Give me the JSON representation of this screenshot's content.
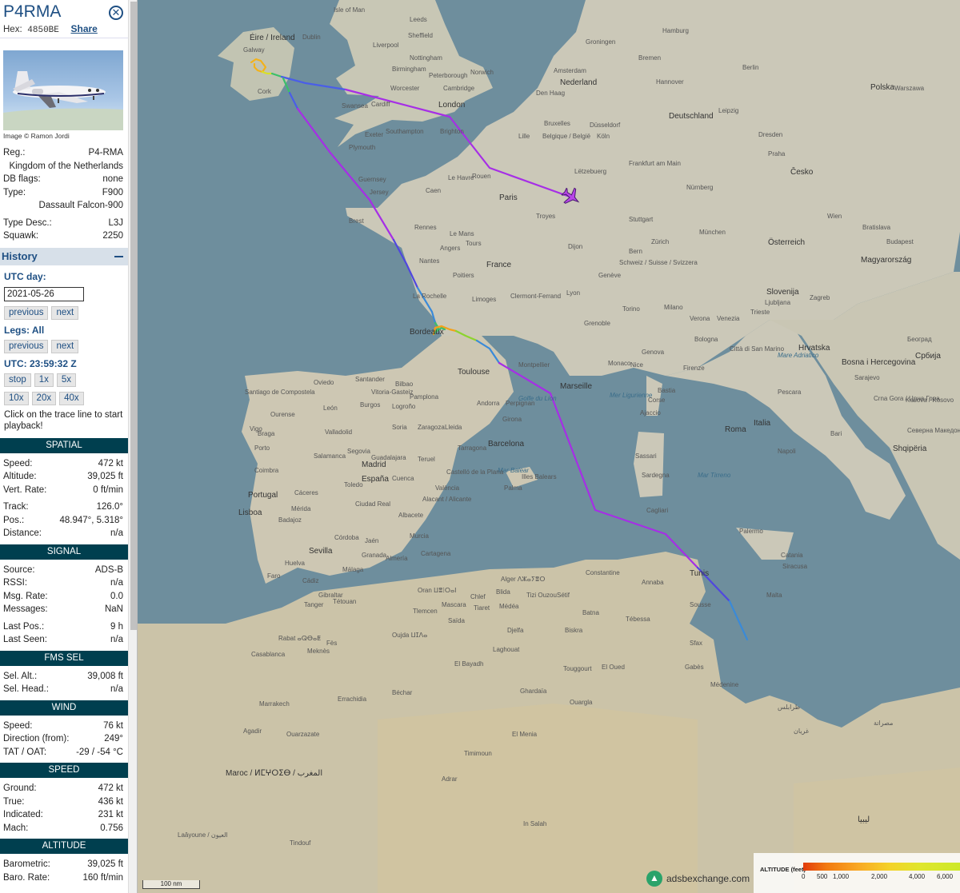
{
  "aircraft": {
    "callsign": "P4RMA",
    "hex_label": "Hex:",
    "hex": "4850BE",
    "share_label": "Share",
    "photo_credit": "Image © Ramon Jordi"
  },
  "details": [
    {
      "key": "Reg.:",
      "value": "P4-RMA"
    },
    {
      "key": "",
      "value": "Kingdom of the Netherlands"
    },
    {
      "key": "DB flags:",
      "value": "none"
    },
    {
      "key": "Type:",
      "value": "F900"
    },
    {
      "key": "",
      "value": "Dassault Falcon-900"
    },
    {
      "key": "Type Desc.:",
      "value": "L3J"
    },
    {
      "key": "Squawk:",
      "value": "2250"
    }
  ],
  "history": {
    "title": "History",
    "utc_day_label": "UTC day:",
    "date_value": "2021-05-26",
    "previous": "previous",
    "next": "next",
    "legs_label": "Legs: All",
    "utc_time_label": "UTC: 23:59:32 Z",
    "stop": "stop",
    "x1": "1x",
    "x5": "5x",
    "x10": "10x",
    "x20": "20x",
    "x40": "40x",
    "hint": "Click on the trace line to start playback!"
  },
  "sections": {
    "spatial": "SPATIAL",
    "signal": "SIGNAL",
    "fms": "FMS SEL",
    "wind": "WIND",
    "speed": "SPEED",
    "altitude": "ALTITUDE"
  },
  "spatial": {
    "speed": {
      "key": "Speed:",
      "value": "472 kt"
    },
    "altitude": {
      "key": "Altitude:",
      "value": "39,025 ft"
    },
    "vert_rate": {
      "key": "Vert. Rate:",
      "value": "0 ft/min"
    },
    "track": {
      "key": "Track:",
      "value": "126.0°"
    },
    "pos": {
      "key": "Pos.:",
      "value": "48.947°, 5.318°"
    },
    "distance": {
      "key": "Distance:",
      "value": "n/a"
    }
  },
  "signal": {
    "source": {
      "key": "Source:",
      "value": "ADS-B"
    },
    "rssi": {
      "key": "RSSI:",
      "value": "n/a"
    },
    "msg_rate": {
      "key": "Msg. Rate:",
      "value": "0.0"
    },
    "messages": {
      "key": "Messages:",
      "value": "NaN"
    },
    "last_pos": {
      "key": "Last Pos.:",
      "value": "9 h"
    },
    "last_seen": {
      "key": "Last Seen:",
      "value": "n/a"
    }
  },
  "fms": {
    "sel_alt": {
      "key": "Sel. Alt.:",
      "value": "39,008 ft"
    },
    "sel_head": {
      "key": "Sel. Head.:",
      "value": "n/a"
    }
  },
  "wind": {
    "speed": {
      "key": "Speed:",
      "value": "76 kt"
    },
    "direction": {
      "key": "Direction (from):",
      "value": "249°"
    },
    "tat_oat": {
      "key": "TAT / OAT:",
      "value": "-29 / -54 °C"
    }
  },
  "speed": {
    "ground": {
      "key": "Ground:",
      "value": "472 kt"
    },
    "true": {
      "key": "True:",
      "value": "436 kt"
    },
    "indicated": {
      "key": "Indicated:",
      "value": "231 kt"
    },
    "mach": {
      "key": "Mach:",
      "value": "0.756"
    }
  },
  "altitude": {
    "barometric": {
      "key": "Barometric:",
      "value": "39,025 ft"
    },
    "baro_rate": {
      "key": "Baro. Rate:",
      "value": "160 ft/min"
    }
  },
  "map": {
    "scale_label": "100 nm",
    "attribution": "adsbexchange.com",
    "legend_title": "ALTITUDE (feet)",
    "legend_ticks": [
      "0",
      "500",
      "1,000",
      "2,000",
      "4,000",
      "6,000"
    ],
    "colors": {
      "water": "#6e8e9d",
      "land": "#ccc9bb",
      "trail_high": "#a825e8",
      "trail_mid": "#5a4fe0",
      "sidebar_header": "#003f4f",
      "accent": "#1e4f83"
    },
    "labels": {
      "isle_of_man": "Isle of Man",
      "leeds": "Leeds",
      "sheffield": "Sheffield",
      "liverpool": "Liverpool",
      "nottingham": "Nottingham",
      "birmingham": "Birmingham",
      "peterborough": "Peterborough",
      "norwich": "Norwich",
      "worcester": "Worcester",
      "cambridge": "Cambridge",
      "london": "London",
      "cardiff": "Cardiff",
      "swansea": "Swansea",
      "southampton": "Southampton",
      "brighton": "Brighton",
      "exeter": "Exeter",
      "plymouth": "Plymouth",
      "eire": "Éire / Ireland",
      "dublin": "Dublin",
      "galway": "Galway",
      "cork": "Cork",
      "guernsey": "Guernsey",
      "jersey": "Jersey",
      "groningen": "Groningen",
      "amsterdam": "Amsterdam",
      "nederland": "Nederland",
      "den_haag": "Den Haag",
      "hamburg": "Hamburg",
      "bremen": "Bremen",
      "hannover": "Hannover",
      "berlin": "Berlin",
      "deutschland": "Deutschland",
      "dusseldorf": "Düsseldorf",
      "koln": "Köln",
      "frankfurt": "Frankfurt am Main",
      "leipzig": "Leipzig",
      "dresden": "Dresden",
      "nurnberg": "Nürnberg",
      "munchen": "München",
      "stuttgart": "Stuttgart",
      "praha": "Praha",
      "cesko": "Česko",
      "wien": "Wien",
      "bratislava": "Bratislava",
      "osterreich": "Österreich",
      "budapest": "Budapest",
      "magyarorszag": "Magyarország",
      "warszawa": "Warszawa",
      "polska": "Polska",
      "belgique": "Belgique / België",
      "bruxelles": "Bruxelles",
      "lille": "Lille",
      "luxembourg": "Lëtzebuerg",
      "paris": "Paris",
      "rouen": "Rouen",
      "le_havre": "Le Havre",
      "caen": "Caen",
      "rennes": "Rennes",
      "brest": "Brest",
      "nantes": "Nantes",
      "angers": "Angers",
      "tours": "Tours",
      "le_mans": "Le Mans",
      "france": "France",
      "troyes": "Troyes",
      "dijon": "Dijon",
      "la_rochelle": "La Rochelle",
      "poitiers": "Poitiers",
      "limoges": "Limoges",
      "clermont": "Clermont-Ferrand",
      "lyon": "Lyon",
      "geneve": "Genève",
      "schweiz": "Schweiz / Suisse / Svizzera",
      "bern": "Bern",
      "zurich": "Zürich",
      "grenoble": "Grenoble",
      "bordeaux": "Bordeaux",
      "toulouse": "Toulouse",
      "montpellier": "Montpellier",
      "marseille": "Marseille",
      "nice": "Nice",
      "monaco": "Monaco",
      "andorra": "Andorra",
      "perpignan": "Perpignan",
      "milano": "Milano",
      "torino": "Torino",
      "genova": "Genova",
      "verona": "Verona",
      "venezia": "Venezia",
      "bologna": "Bologna",
      "firenze": "Firenze",
      "italia": "Italia",
      "roma": "Roma",
      "napoli": "Napoli",
      "bari": "Bari",
      "pescara": "Pescara",
      "sanmarino": "Città di San Marino",
      "zagreb": "Zagreb",
      "slovenija": "Slovenija",
      "ljubljana": "Ljubljana",
      "trieste": "Trieste",
      "hrvatska": "Hrvatska",
      "bosna": "Bosna i Hercegovina",
      "sarajevo": "Sarajevo",
      "beograd": "Београд",
      "srbija": "Србија",
      "crnagora": "Crna Gora / Црна Гора",
      "kosovo": "Kosova / Kosovo",
      "shqiperia": "Shqipëria",
      "severna": "Северна Македонија",
      "sardegna": "Sardegna",
      "sassari": "Sassari",
      "cagliari": "Cagliari",
      "palermo": "Palermo",
      "catania": "Catania",
      "siracusa": "Siracusa",
      "malta": "Malta",
      "corse": "Corse",
      "ajaccio": "Ajaccio",
      "bastia": "Bastia",
      "espana": "España",
      "madrid": "Madrid",
      "barcelona": "Barcelona",
      "valencia": "València",
      "zaragoza": "Zaragoza",
      "bilbao": "Bilbao",
      "vitoria": "Vitoria-Gasteiz",
      "santander": "Santander",
      "oviedo": "Oviedo",
      "santiago": "Santiago de Compostela",
      "vigo": "Vigo",
      "ourense": "Ourense",
      "leon": "León",
      "burgos": "Burgos",
      "valladolid": "Valladolid",
      "salamanca": "Salamanca",
      "segovia": "Segovia",
      "toledo": "Toledo",
      "ciudad_real": "Ciudad Real",
      "cuenca": "Cuenca",
      "albacete": "Albacete",
      "murcia": "Murcia",
      "alicante": "Alacant / Alicante",
      "cartagena": "Cartagena",
      "almeria": "Almería",
      "granada": "Granada",
      "jaen": "Jaén",
      "cordoba": "Córdoba",
      "sevilla": "Sevilla",
      "huelva": "Huelva",
      "malaga": "Málaga",
      "cadiz": "Cádiz",
      "gibraltar": "Gibraltar",
      "badajoz": "Badajoz",
      "caceres": "Cáceres",
      "merida": "Mérida",
      "portugal": "Portugal",
      "lisboa": "Lisboa",
      "porto": "Porto",
      "coimbra": "Coimbra",
      "braga": "Braga",
      "faro": "Faro",
      "palma": "Palma",
      "illes_balears": "Illes Balears",
      "mar_balear": "Mar Balear",
      "castello": "Castelló de la Plana",
      "tarragona": "Tarragona",
      "lleida": "Lleida",
      "girona": "Girona",
      "pamplona": "Pamplona",
      "logrono": "Logroño",
      "soria": "Soria",
      "teruel": "Teruel",
      "guadalajara": "Guadalajara",
      "tanger": "Tanger",
      "tetouan": "Tétouan",
      "rabat": "Rabat ⴰⵕⴱⴰⵟ",
      "casablanca": "Casablanca",
      "fes": "Fès",
      "meknes": "Meknès",
      "oujda": "Oujda ⵡⵊⴷⴰ",
      "alger": "Alger ⴷⵣⴰⵢⴻⵔ",
      "oran": "Oran ⵡⴻⵂⵔⴰⵏ",
      "constantine": "Constantine",
      "setif": "Sétif",
      "batna": "Batna",
      "biskra": "Biskra",
      "tunis": "Tunis",
      "sousse": "Sousse",
      "sfax": "Sfax",
      "tebessa": "Tébessa",
      "annaba": "Annaba",
      "tizi": "Tizi Ouzou",
      "blida": "Blida",
      "medea": "Médéa",
      "chlef": "Chlef",
      "tiaret": "Tiaret",
      "mascara": "Mascara",
      "tlemcen": "Tlemcen",
      "saida": "Saïda",
      "djelfa": "Djelfa",
      "laghouat": "Laghouat",
      "ghardaia": "Ghardaïa",
      "ouargla": "Ouargla",
      "touggourt": "Touggourt",
      "el_oued": "El Oued",
      "el_bayadh": "El Bayadh",
      "bechar": "Béchar",
      "adrar": "Adrar",
      "timimoun": "Timimoun",
      "el_menia": "El Menia",
      "ouarzazate": "Ouarzazate",
      "agadir": "Agadir",
      "marrakech": "Marrakech",
      "errachidia": "Errachidia",
      "maroc": "Maroc / ⵍⵎⵖⵔⵉⴱ / المغرب",
      "in_salah": "In Salah",
      "laayoune": "Laâyoune / العيون",
      "tindouf": "Tindouf",
      "gabes": "Gabès",
      "medenine": "Médenine",
      "tripoli": "طرابلس",
      "misrata": "مصراتة",
      "gharyan": "غريان",
      "libya": "ليبيا",
      "mar_tirreno": "Mar Tirreno",
      "mar_adriatico": "Mare Adriatico",
      "mer_ligurienne": "Mer Ligurienne",
      "golfe_lion": "Golfe du Lion"
    }
  }
}
